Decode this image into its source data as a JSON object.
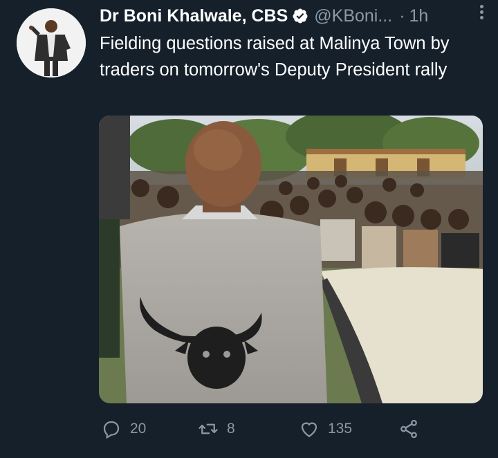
{
  "tweet": {
    "display_name": "Dr Boni Khalwale, CBS",
    "handle": "@KBoni...",
    "separator": "·",
    "time": "1h",
    "text": "Fielding questions raised at Malinya Town by traders on tomorrow's Deputy President rally"
  },
  "actions": {
    "replies": "20",
    "retweets": "8",
    "likes": "135"
  },
  "icons": [
    "verified-badge-icon",
    "more-options-icon",
    "reply-icon",
    "retweet-icon",
    "like-icon",
    "share-icon"
  ],
  "colors": {
    "background": "#15202b",
    "secondary_text": "#8b98a5",
    "verified": "#ffffff"
  }
}
